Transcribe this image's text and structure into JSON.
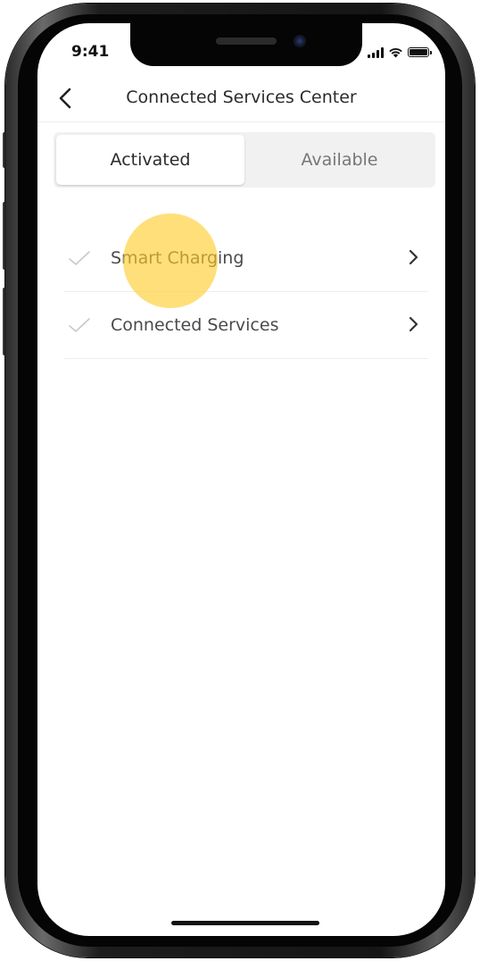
{
  "status_bar": {
    "time": "9:41",
    "signal_icon": "cellular-signal-icon",
    "wifi_icon": "wifi-icon",
    "battery_icon": "battery-icon"
  },
  "nav": {
    "title": "Connected Services Center",
    "back_icon": "chevron-left-icon"
  },
  "tabs": [
    {
      "label": "Activated",
      "selected": true
    },
    {
      "label": "Available",
      "selected": false
    }
  ],
  "services": [
    {
      "label": "Smart Charging",
      "status_icon": "checkmark-icon",
      "action_icon": "chevron-right-icon"
    },
    {
      "label": "Connected Services",
      "status_icon": "checkmark-icon",
      "action_icon": "chevron-right-icon"
    }
  ],
  "colors": {
    "touch_indicator": "#FFCC29",
    "text_primary": "#2b2b2b",
    "text_secondary": "#777777",
    "segment_bg": "#f1f1f1"
  }
}
